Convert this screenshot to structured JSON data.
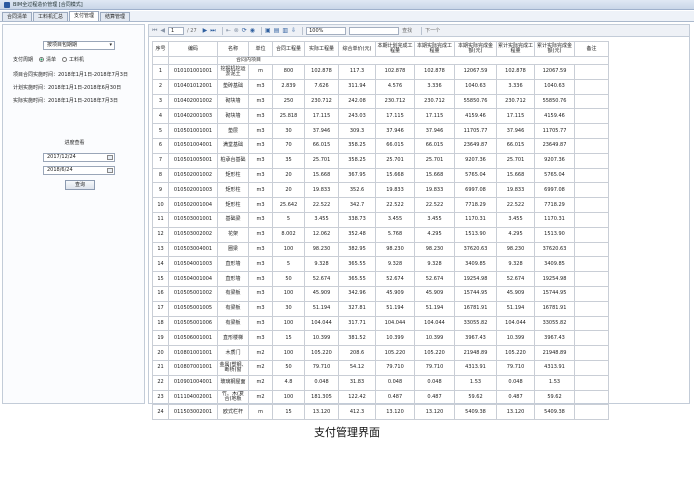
{
  "window": {
    "title": "BIM全过程造价管理 [合同模式]"
  },
  "tabs": [
    {
      "label": "合同清单",
      "active": false
    },
    {
      "label": "工料机汇总",
      "active": false
    },
    {
      "label": "支付管理",
      "active": true
    },
    {
      "label": "结算管理",
      "active": false
    }
  ],
  "sidebar": {
    "select_value": "按项目包期期",
    "period_label": "支付周期",
    "radio_list": "清单",
    "radio_material": "工料机",
    "info_lines": [
      "项目合同实施时间：2018年1月1日-2018年7月3日",
      "计划实施时间：2018年1月1日-2018年6月30日",
      "实际实施时间：2018年1月1日-2018年7月3日"
    ],
    "progress_label": "进度查看",
    "date_start": "2017/12/24",
    "date_end": "2018/6/24",
    "query_label": "查询"
  },
  "toolbar": {
    "page_value": "1",
    "page_total": "/ 27",
    "zoom_value": "100%",
    "find_label": "查找",
    "next_label": "下一个"
  },
  "table": {
    "headers": [
      "序号",
      "编码",
      "名称",
      "单位",
      "合同工程量",
      "实际工程量",
      "综合单价(元)",
      "本期计划完成工程量",
      "本期实际完成工程量",
      "本期实际完成金额(元)",
      "累计实际完成工程量",
      "累计实际完成金额(元)",
      "备注"
    ],
    "group_label": "合同内项目",
    "rows": [
      [
        "1",
        "010101001001",
        "挖掘机挖运淤泥土",
        "m",
        "800",
        "102.878",
        "117.3",
        "102.878",
        "102.878",
        "12067.59",
        "102.878",
        "12067.59",
        ""
      ],
      [
        "2",
        "010401012001",
        "垫砖基础",
        "m3",
        "2.839",
        "7.626",
        "311.94",
        "4.576",
        "3.336",
        "1040.63",
        "3.336",
        "1040.63",
        ""
      ],
      [
        "3",
        "010402001002",
        "砌块墙",
        "m3",
        "250",
        "230.712",
        "242.08",
        "230.712",
        "230.712",
        "55850.76",
        "230.712",
        "55850.76",
        ""
      ],
      [
        "4",
        "010402001003",
        "砌块墙",
        "m3",
        "25.818",
        "17.115",
        "243.03",
        "17.115",
        "17.115",
        "4159.46",
        "17.115",
        "4159.46",
        ""
      ],
      [
        "5",
        "010501001001",
        "垫层",
        "m3",
        "30",
        "37.946",
        "309.3",
        "37.946",
        "37.946",
        "11705.77",
        "37.946",
        "11705.77",
        ""
      ],
      [
        "6",
        "010501004001",
        "满堂基础",
        "m3",
        "70",
        "66.015",
        "358.25",
        "66.015",
        "66.015",
        "23649.87",
        "66.015",
        "23649.87",
        ""
      ],
      [
        "7",
        "010501005001",
        "桩承台基础",
        "m3",
        "35",
        "25.701",
        "358.25",
        "25.701",
        "25.701",
        "9207.36",
        "25.701",
        "9207.36",
        ""
      ],
      [
        "8",
        "010502001002",
        "矩形柱",
        "m3",
        "20",
        "15.668",
        "367.95",
        "15.668",
        "15.668",
        "5765.04",
        "15.668",
        "5765.04",
        ""
      ],
      [
        "9",
        "010502001003",
        "矩形柱",
        "m3",
        "20",
        "19.833",
        "352.6",
        "19.833",
        "19.833",
        "6997.08",
        "19.833",
        "6997.08",
        ""
      ],
      [
        "10",
        "010502001004",
        "矩形柱",
        "m3",
        "25.642",
        "22.522",
        "342.7",
        "22.522",
        "22.522",
        "7718.29",
        "22.522",
        "7718.29",
        ""
      ],
      [
        "11",
        "010503001001",
        "基础梁",
        "m3",
        "5",
        "3.455",
        "338.73",
        "3.455",
        "3.455",
        "1170.31",
        "3.455",
        "1170.31",
        ""
      ],
      [
        "12",
        "010503002002",
        "花架",
        "m3",
        "8.002",
        "12.062",
        "352.48",
        "5.768",
        "4.295",
        "1513.90",
        "4.295",
        "1513.90",
        ""
      ],
      [
        "13",
        "010503004001",
        "圈梁",
        "m3",
        "100",
        "98.230",
        "382.95",
        "98.230",
        "98.230",
        "37620.63",
        "98.230",
        "37620.63",
        ""
      ],
      [
        "14",
        "010504001003",
        "直形墙",
        "m3",
        "5",
        "9.328",
        "365.55",
        "9.328",
        "9.328",
        "3409.85",
        "9.328",
        "3409.85",
        ""
      ],
      [
        "15",
        "010504001004",
        "直形墙",
        "m3",
        "50",
        "52.674",
        "365.55",
        "52.674",
        "52.674",
        "19254.98",
        "52.674",
        "19254.98",
        ""
      ],
      [
        "16",
        "010505001002",
        "有梁板",
        "m3",
        "100",
        "45.909",
        "342.96",
        "45.909",
        "45.909",
        "15744.95",
        "45.909",
        "15744.95",
        ""
      ],
      [
        "17",
        "010505001005",
        "有梁板",
        "m3",
        "30",
        "51.194",
        "327.81",
        "51.194",
        "51.194",
        "16781.91",
        "51.194",
        "16781.91",
        ""
      ],
      [
        "18",
        "010505001006",
        "有梁板",
        "m3",
        "100",
        "104.044",
        "317.71",
        "104.044",
        "104.044",
        "33055.82",
        "104.044",
        "33055.82",
        ""
      ],
      [
        "19",
        "010506001001",
        "直形楼梯",
        "m3",
        "15",
        "10.399",
        "381.52",
        "10.399",
        "10.399",
        "3967.43",
        "10.399",
        "3967.43",
        ""
      ],
      [
        "20",
        "010801001001",
        "木质门",
        "m2",
        "100",
        "105.220",
        "208.6",
        "105.220",
        "105.220",
        "21948.89",
        "105.220",
        "21948.89",
        ""
      ],
      [
        "21",
        "010807001001",
        "金属(塑钢、断桥)窗",
        "m2",
        "50",
        "79.710",
        "54.12",
        "79.710",
        "79.710",
        "4313.91",
        "79.710",
        "4313.91",
        ""
      ],
      [
        "22",
        "010901004001",
        "玻璃钢屋面",
        "m2",
        "4.8",
        "0.048",
        "31.83",
        "0.048",
        "0.048",
        "1.53",
        "0.048",
        "1.53",
        ""
      ],
      [
        "23",
        "011104002001",
        "竹、木(复合)地板",
        "m2",
        "100",
        "181.305",
        "122.42",
        "0.487",
        "0.487",
        "59.62",
        "0.487",
        "59.62",
        ""
      ],
      [
        "24",
        "011503002001",
        "欧式栏杆",
        "m",
        "15",
        "13.120",
        "412.3",
        "13.120",
        "13.120",
        "5409.38",
        "13.120",
        "5409.38",
        ""
      ]
    ]
  },
  "caption": "支付管理界面"
}
